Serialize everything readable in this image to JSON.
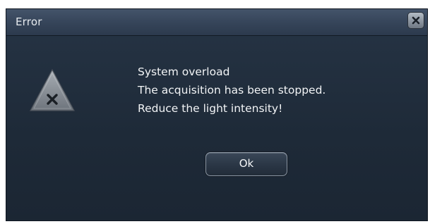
{
  "window": {
    "title": "Error"
  },
  "titlebar": {
    "close_icon": "close-icon"
  },
  "content": {
    "icon": "warning-triangle-icon",
    "messages": [
      "System overload",
      "The acquisition has been stopped.",
      "Reduce the light intensity!"
    ]
  },
  "buttons": {
    "ok_label": "Ok"
  },
  "colors": {
    "dialog_background": "#1e2a38",
    "titlebar": "#36455a",
    "text": "#f2f4f6"
  }
}
